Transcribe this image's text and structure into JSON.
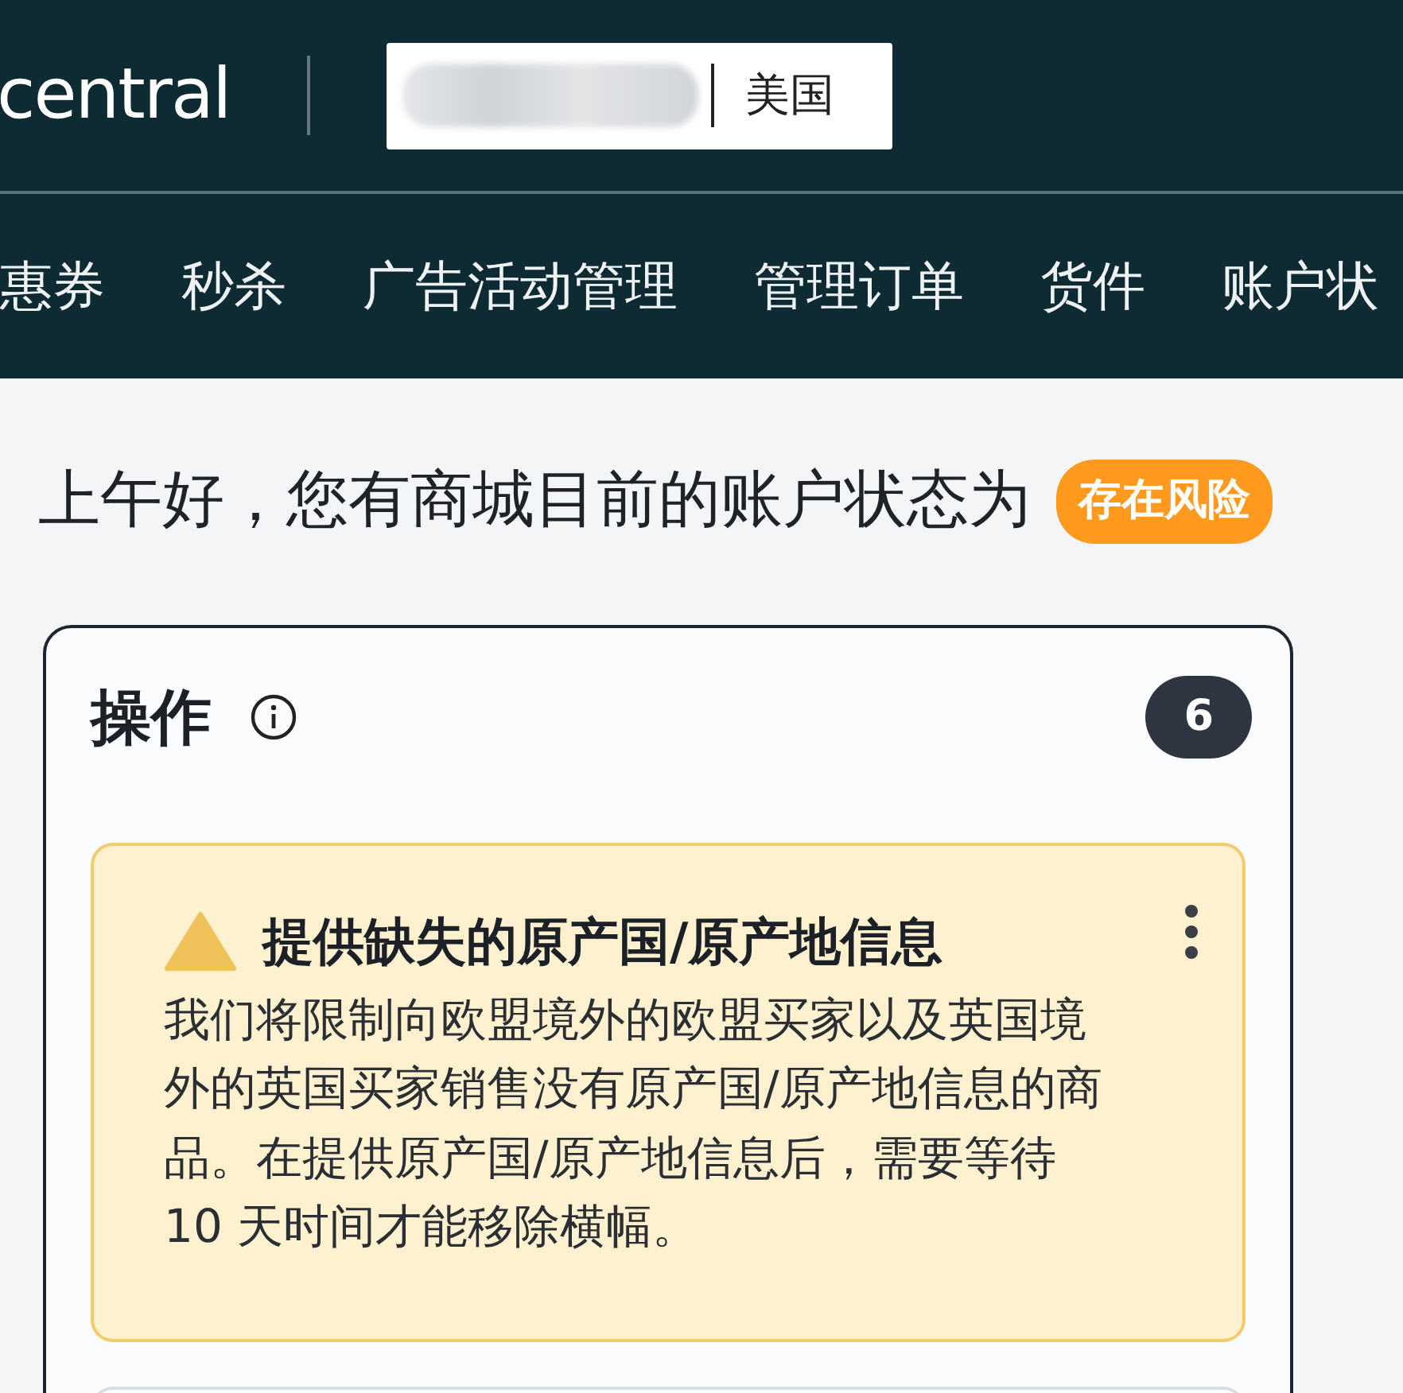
{
  "header": {
    "logo_text": "central",
    "store_selector": {
      "region": "美国"
    }
  },
  "nav": [
    {
      "label": "惠券"
    },
    {
      "label": "秒杀"
    },
    {
      "label": "广告活动管理"
    },
    {
      "label": "管理订单"
    },
    {
      "label": "货件"
    },
    {
      "label": "账户状"
    }
  ],
  "greeting": {
    "text": "上午好，您有商城目前的账户状态为",
    "status_badge": "存在风险"
  },
  "actions_card": {
    "title": "操作",
    "count": "6",
    "alerts": [
      {
        "kind": "warning",
        "title": "提供缺失的原产国/原产地信息",
        "body": "我们将限制向欧盟境外的欧盟买家以及英国境外的英国买家销售没有原产国/原产地信息的商品。在提供原产国/原产地信息后，需要等待 10 天时间才能移除横幅。"
      }
    ]
  }
}
